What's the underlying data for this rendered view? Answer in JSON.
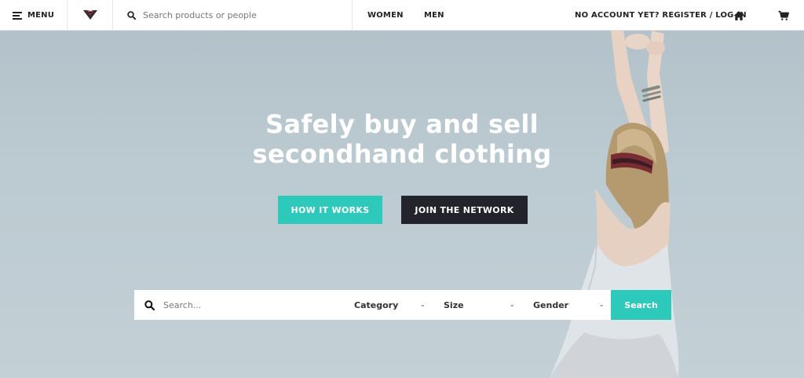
{
  "header": {
    "menu_label": "MENU",
    "search_placeholder": "Search products or people",
    "nav": [
      "WOMEN",
      "MEN"
    ],
    "account_text": "NO ACCOUNT YET? REGISTER / LOG IN",
    "icons": [
      "menu-icon",
      "brand-logo",
      "search-icon",
      "home-icon",
      "cart-icon"
    ]
  },
  "hero": {
    "title_line1": "Safely buy and sell",
    "title_line2": "secondhand clothing",
    "primary_button": "HOW IT WORKS",
    "secondary_button": "JOIN THE NETWORK"
  },
  "filter": {
    "search_placeholder": "Search...",
    "category_label": "Category",
    "size_label": "Size",
    "gender_label": "Gender",
    "submit_label": "Search"
  },
  "colors": {
    "accent": "#2dc9bb",
    "dark_button": "#23232b",
    "hero_background": "#bccad1"
  }
}
